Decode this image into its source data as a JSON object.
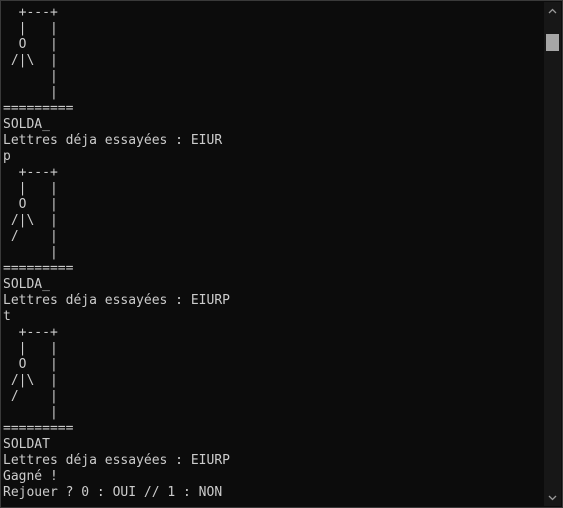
{
  "console": {
    "lines": [
      "  +---+",
      "  |   |",
      "  O   |",
      " /|\\  |",
      "      |",
      "      |",
      "=========",
      "SOLDA_",
      "Lettres déja essayées : EIUR",
      "p",
      "  +---+",
      "  |   |",
      "  O   |",
      " /|\\  |",
      " /    |",
      "      |",
      "=========",
      "SOLDA_",
      "Lettres déja essayées : EIURP",
      "t",
      "  +---+",
      "  |   |",
      "  O   |",
      " /|\\  |",
      " /    |",
      "      |",
      "=========",
      "SOLDAT",
      "Lettres déja essayées : EIURP",
      "Gagné !",
      "Rejouer ? 0 : OUI // 1 : NON"
    ]
  },
  "scrollbar": {
    "up_icon": "chevron-up-icon",
    "down_icon": "chevron-down-icon",
    "thumb_color": "#a6a6a6",
    "track_color": "#171717"
  }
}
